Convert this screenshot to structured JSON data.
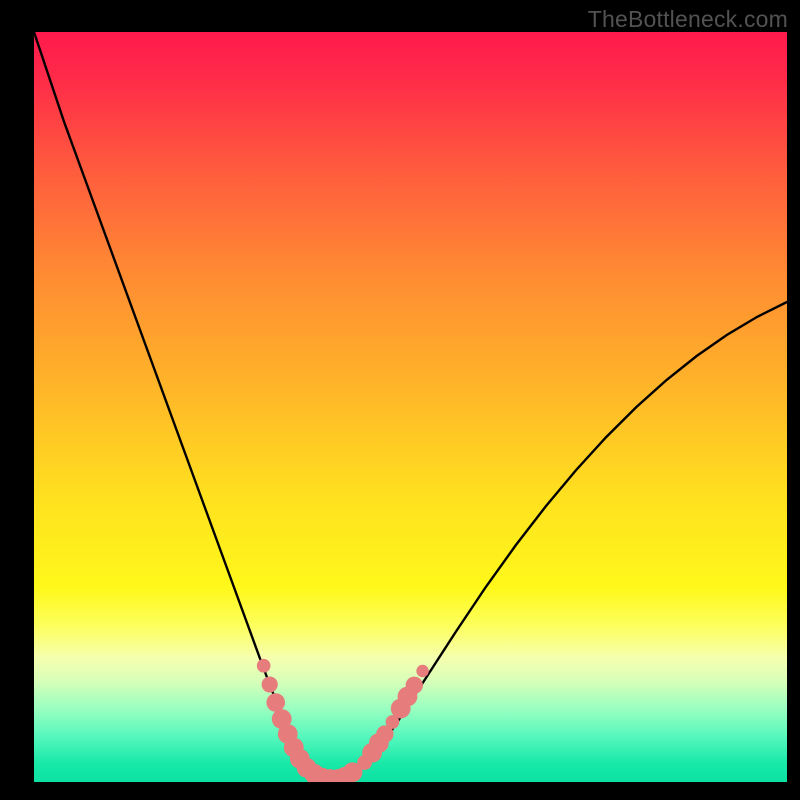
{
  "watermark": "TheBottleneck.com",
  "colors": {
    "frame": "#000000",
    "gradient_stops": [
      {
        "offset": 0.0,
        "color": "#ff1a4d"
      },
      {
        "offset": 0.06,
        "color": "#ff2a49"
      },
      {
        "offset": 0.18,
        "color": "#ff5a3e"
      },
      {
        "offset": 0.32,
        "color": "#ff8a33"
      },
      {
        "offset": 0.48,
        "color": "#ffb728"
      },
      {
        "offset": 0.62,
        "color": "#ffe11f"
      },
      {
        "offset": 0.74,
        "color": "#fff81a"
      },
      {
        "offset": 0.79,
        "color": "#fdff5a"
      },
      {
        "offset": 0.835,
        "color": "#f5ffb0"
      },
      {
        "offset": 0.865,
        "color": "#d8ffb8"
      },
      {
        "offset": 0.9,
        "color": "#9dffc0"
      },
      {
        "offset": 0.94,
        "color": "#55f7bd"
      },
      {
        "offset": 0.975,
        "color": "#18e9a8"
      },
      {
        "offset": 1.0,
        "color": "#0ce2a3"
      }
    ],
    "curve": "#000000",
    "marker_fill": "#e77c7c",
    "marker_stroke": "#d46a6a"
  },
  "chart_data": {
    "type": "line",
    "title": "",
    "xlabel": "",
    "ylabel": "",
    "xlim": [
      0,
      100
    ],
    "ylim": [
      0,
      100
    ],
    "series": [
      {
        "name": "bottleneck-curve",
        "x": [
          0,
          2,
          4,
          6,
          8,
          10,
          12,
          14,
          16,
          18,
          20,
          22,
          24,
          26,
          28,
          30,
          31,
          32,
          33,
          34,
          35,
          36,
          37,
          38,
          39,
          40,
          41,
          42,
          44,
          46,
          48,
          52,
          56,
          60,
          64,
          68,
          72,
          76,
          80,
          84,
          88,
          92,
          96,
          100
        ],
        "y": [
          100,
          94,
          88,
          82.5,
          77,
          71.5,
          66,
          60.5,
          55,
          49.5,
          44,
          38.5,
          33,
          27.5,
          22,
          16.5,
          13.8,
          11.2,
          8.8,
          6.6,
          4.6,
          3.0,
          1.8,
          1.0,
          0.5,
          0.35,
          0.45,
          0.9,
          2.4,
          4.8,
          7.6,
          13.8,
          20.0,
          26.0,
          31.6,
          36.8,
          41.6,
          46.0,
          50.0,
          53.6,
          56.8,
          59.6,
          62.0,
          64.0
        ]
      }
    ],
    "markers": [
      {
        "x": 30.5,
        "y": 15.5,
        "r": 1.1
      },
      {
        "x": 31.3,
        "y": 13.0,
        "r": 1.3
      },
      {
        "x": 32.1,
        "y": 10.6,
        "r": 1.5
      },
      {
        "x": 32.9,
        "y": 8.4,
        "r": 1.6
      },
      {
        "x": 33.7,
        "y": 6.4,
        "r": 1.6
      },
      {
        "x": 34.5,
        "y": 4.6,
        "r": 1.6
      },
      {
        "x": 35.3,
        "y": 3.1,
        "r": 1.6
      },
      {
        "x": 36.2,
        "y": 1.9,
        "r": 1.6
      },
      {
        "x": 37.2,
        "y": 1.1,
        "r": 1.6
      },
      {
        "x": 38.2,
        "y": 0.6,
        "r": 1.6
      },
      {
        "x": 39.3,
        "y": 0.4,
        "r": 1.6
      },
      {
        "x": 40.4,
        "y": 0.4,
        "r": 1.6
      },
      {
        "x": 41.3,
        "y": 0.7,
        "r": 1.6
      },
      {
        "x": 42.3,
        "y": 1.3,
        "r": 1.6
      },
      {
        "x": 43.9,
        "y": 2.6,
        "r": 1.2
      },
      {
        "x": 44.9,
        "y": 3.9,
        "r": 1.6
      },
      {
        "x": 45.8,
        "y": 5.2,
        "r": 1.6
      },
      {
        "x": 46.6,
        "y": 6.4,
        "r": 1.4
      },
      {
        "x": 47.6,
        "y": 8.0,
        "r": 1.1
      },
      {
        "x": 48.7,
        "y": 9.8,
        "r": 1.6
      },
      {
        "x": 49.6,
        "y": 11.4,
        "r": 1.6
      },
      {
        "x": 50.5,
        "y": 12.9,
        "r": 1.4
      },
      {
        "x": 51.6,
        "y": 14.8,
        "r": 1.0
      }
    ]
  }
}
